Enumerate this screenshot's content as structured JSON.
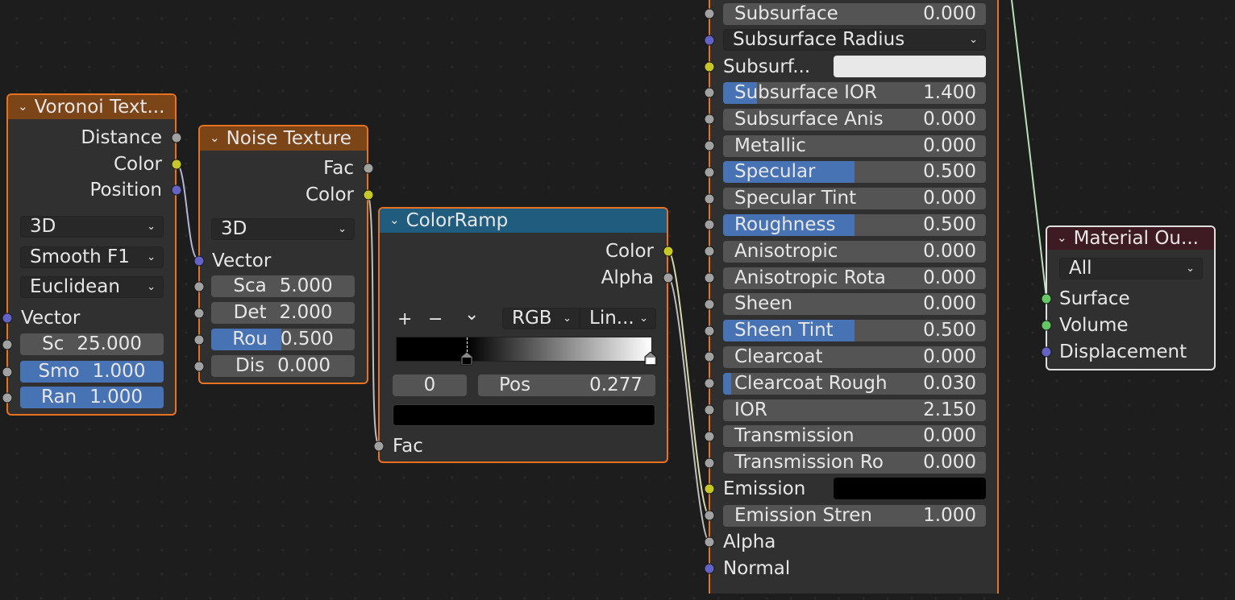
{
  "colors": {
    "selected_border": "#e8721f",
    "texture_header": "#7c4518",
    "converter_header": "#1f5c7d",
    "output_header": "#3e1a22",
    "field": "#545454",
    "field_fill": "#4772b3",
    "socket_float": "#a1a1a1",
    "socket_color": "#c7c729",
    "socket_vector": "#6363c7",
    "socket_shader": "#63c763"
  },
  "voronoi": {
    "title": "Voronoi Text...",
    "outputs": [
      "Distance",
      "Color",
      "Position"
    ],
    "dimensions": "3D",
    "feature": "Smooth F1",
    "distance": "Euclidean",
    "input_vector": "Vector",
    "fields": [
      {
        "label": "Sc",
        "value": "25.000",
        "fill": 0
      },
      {
        "label": "Smo",
        "value": "1.000",
        "fill": 1
      },
      {
        "label": "Ran",
        "value": "1.000",
        "fill": 1
      }
    ]
  },
  "noise": {
    "title": "Noise Texture",
    "outputs": [
      "Fac",
      "Color"
    ],
    "dimensions": "3D",
    "input_vector": "Vector",
    "fields": [
      {
        "label": "Sca",
        "value": "5.000",
        "fill": 0
      },
      {
        "label": "Det",
        "value": "2.000",
        "fill": 0
      },
      {
        "label": "Rou",
        "value": "0.500",
        "fill": 0.5
      },
      {
        "label": "Dis",
        "value": "0.000",
        "fill": 0
      }
    ]
  },
  "colorramp": {
    "title": "ColorRamp",
    "outputs": [
      "Color",
      "Alpha"
    ],
    "add": "+",
    "remove": "−",
    "menu": "⌄",
    "color_mode": "RGB",
    "interpolation": "Lin...",
    "stops": [
      {
        "position": 0.277,
        "color": "#000000"
      },
      {
        "position": 1.0,
        "color": "#ffffff"
      }
    ],
    "active_index": "0",
    "pos_label": "Pos",
    "pos_value": "0.277",
    "active_color": "#000000",
    "input": "Fac"
  },
  "principled": {
    "rows": [
      {
        "type": "field",
        "label": "Subsurface",
        "value": "0.000",
        "fill": 0,
        "socket": "g"
      },
      {
        "type": "dropdown",
        "label": "Subsurface Radius",
        "socket": "b"
      },
      {
        "type": "color",
        "label": "Subsurf...",
        "color": "#e8e8e8",
        "socket": "y"
      },
      {
        "type": "field",
        "label": "Subsurface IOR",
        "value": "1.400",
        "fill": 0.13,
        "socket": "g"
      },
      {
        "type": "field",
        "label": "Subsurface Anis",
        "value": "0.000",
        "fill": 0,
        "socket": "g"
      },
      {
        "type": "field",
        "label": "Metallic",
        "value": "0.000",
        "fill": 0,
        "socket": "g"
      },
      {
        "type": "field",
        "label": "Specular",
        "value": "0.500",
        "fill": 0.5,
        "socket": "g"
      },
      {
        "type": "field",
        "label": "Specular Tint",
        "value": "0.000",
        "fill": 0,
        "socket": "g"
      },
      {
        "type": "field",
        "label": "Roughness",
        "value": "0.500",
        "fill": 0.5,
        "socket": "g"
      },
      {
        "type": "field",
        "label": "Anisotropic",
        "value": "0.000",
        "fill": 0,
        "socket": "g"
      },
      {
        "type": "field",
        "label": "Anisotropic Rota",
        "value": "0.000",
        "fill": 0,
        "socket": "g"
      },
      {
        "type": "field",
        "label": "Sheen",
        "value": "0.000",
        "fill": 0,
        "socket": "g"
      },
      {
        "type": "field",
        "label": "Sheen Tint",
        "value": "0.500",
        "fill": 0.5,
        "socket": "g"
      },
      {
        "type": "field",
        "label": "Clearcoat",
        "value": "0.000",
        "fill": 0,
        "socket": "g"
      },
      {
        "type": "field",
        "label": "Clearcoat Rough",
        "value": "0.030",
        "fill": 0.03,
        "socket": "g"
      },
      {
        "type": "field",
        "label": "IOR",
        "value": "2.150",
        "fill": 0,
        "socket": "g"
      },
      {
        "type": "field",
        "label": "Transmission",
        "value": "0.000",
        "fill": 0,
        "socket": "g"
      },
      {
        "type": "field",
        "label": "Transmission Ro",
        "value": "0.000",
        "fill": 0,
        "socket": "g"
      },
      {
        "type": "color",
        "label": "Emission",
        "color": "#000000",
        "socket": "y"
      },
      {
        "type": "field",
        "label": "Emission Stren",
        "value": "1.000",
        "fill": 0,
        "socket": "g"
      },
      {
        "type": "socket",
        "label": "Alpha",
        "socket": "g"
      },
      {
        "type": "socket",
        "label": "Normal",
        "socket": "b"
      }
    ]
  },
  "material_output": {
    "title": "Material Ou...",
    "target": "All",
    "inputs": [
      "Surface",
      "Volume",
      "Displacement"
    ]
  }
}
